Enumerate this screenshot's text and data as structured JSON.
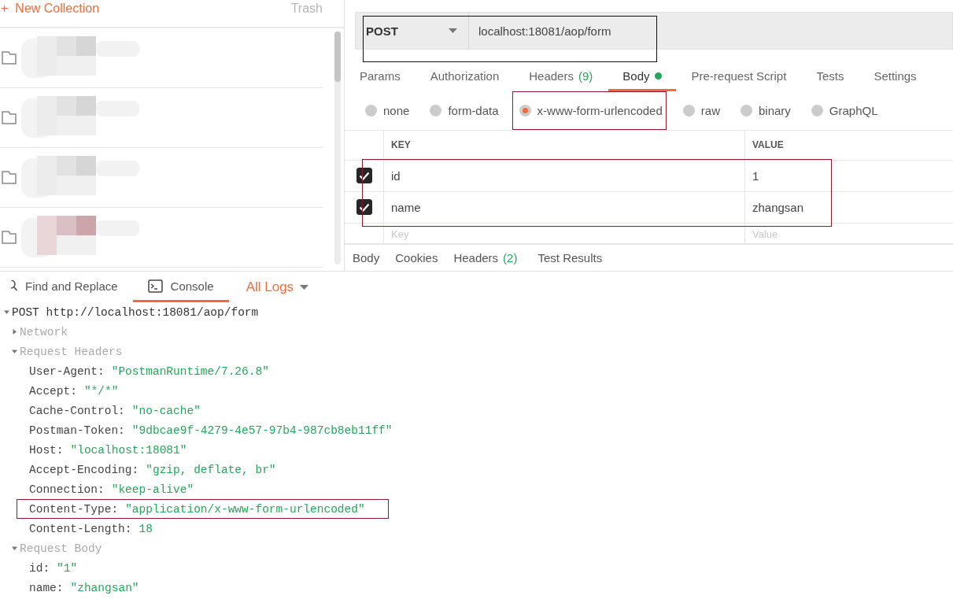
{
  "sidebar": {
    "plus": "+",
    "new_collection": "New Collection",
    "trash": "Trash",
    "collections": [
      {
        "kind": "folder"
      },
      {
        "kind": "folder"
      },
      {
        "kind": "folder"
      },
      {
        "kind": "folder"
      }
    ]
  },
  "request": {
    "method": "POST",
    "url": "localhost:18081/aop/form",
    "highlighted": true
  },
  "request_tabs": [
    {
      "label": "Params",
      "selected": false
    },
    {
      "label": "Authorization",
      "selected": false
    },
    {
      "label": "Headers",
      "count": "(9)",
      "selected": false
    },
    {
      "label": "Body",
      "dot": true,
      "selected": true
    },
    {
      "label": "Pre-request Script",
      "selected": false
    },
    {
      "label": "Tests",
      "selected": false
    },
    {
      "label": "Settings",
      "selected": false
    }
  ],
  "body_types": [
    {
      "label": "none",
      "selected": false,
      "highlighted": false
    },
    {
      "label": "form-data",
      "selected": false,
      "highlighted": false
    },
    {
      "label": "x-www-form-urlencoded",
      "selected": true,
      "highlighted": true
    },
    {
      "label": "raw",
      "selected": false,
      "highlighted": false
    },
    {
      "label": "binary",
      "selected": false,
      "highlighted": false
    },
    {
      "label": "GraphQL",
      "selected": false,
      "highlighted": false
    }
  ],
  "params_table": {
    "columns": [
      "KEY",
      "VALUE"
    ],
    "highlighted": true,
    "rows": [
      {
        "key": "id",
        "value": "1",
        "checked": true
      },
      {
        "key": "name",
        "value": "zhangsan",
        "checked": true
      }
    ],
    "new_row": {
      "key_placeholder": "Key",
      "value_placeholder": "Value"
    }
  },
  "response_tabs": [
    {
      "label": "Body"
    },
    {
      "label": "Cookies"
    },
    {
      "label": "Headers",
      "count": "(2)"
    },
    {
      "label": "Test Results"
    }
  ],
  "console": {
    "tabs": [
      {
        "label": "Find and Replace",
        "kind": "search",
        "selected": false
      },
      {
        "label": "Console",
        "kind": "console",
        "selected": true
      }
    ],
    "filter": "All Logs",
    "log": {
      "title": "POST http://localhost:18081/aop/form",
      "expanded": true,
      "sections": [
        {
          "label": "Network",
          "expanded": false
        },
        {
          "label": "Request Headers",
          "expanded": true,
          "entries": [
            {
              "key": "User-Agent:",
              "value": "\"PostmanRuntime/7.26.8\"",
              "highlighted": false
            },
            {
              "key": "Accept:",
              "value": "\"*/*\"",
              "highlighted": false
            },
            {
              "key": "Cache-Control:",
              "value": "\"no-cache\"",
              "highlighted": false
            },
            {
              "key": "Postman-Token:",
              "value": "\"9dbcae9f-4279-4e57-97b4-987cb8eb11ff\"",
              "highlighted": false
            },
            {
              "key": "Host:",
              "value": "\"localhost:18081\"",
              "highlighted": false
            },
            {
              "key": "Accept-Encoding:",
              "value": "\"gzip, deflate, br\"",
              "highlighted": false
            },
            {
              "key": "Connection:",
              "value": "\"keep-alive\"",
              "highlighted": false
            },
            {
              "key": "Content-Type:",
              "value": "\"application/x-www-form-urlencoded\"",
              "highlighted": true
            },
            {
              "key": "Content-Length:",
              "value": "18",
              "highlighted": false
            }
          ]
        },
        {
          "label": "Request Body",
          "expanded": true,
          "entries": [
            {
              "key": "id:",
              "value": "\"1\"",
              "highlighted": false
            },
            {
              "key": "name:",
              "value": "\"zhangsan\"",
              "highlighted": false
            }
          ]
        }
      ]
    }
  }
}
